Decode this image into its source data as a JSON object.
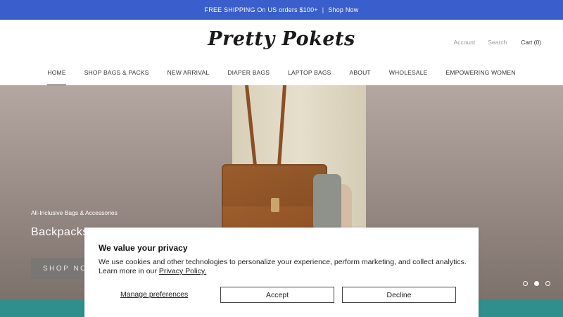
{
  "announcement": {
    "text": "FREE SHIPPING On US orders $100+",
    "separator": "|",
    "link": "Shop Now"
  },
  "header": {
    "logo": "Pretty Pokets",
    "account": "Account",
    "search": "Search",
    "cart": "Cart (0)"
  },
  "nav": {
    "items": [
      {
        "label": "HOME"
      },
      {
        "label": "SHOP BAGS & PACKS"
      },
      {
        "label": "NEW ARRIVAL"
      },
      {
        "label": "DIAPER BAGS"
      },
      {
        "label": "LAPTOP BAGS"
      },
      {
        "label": "ABOUT"
      },
      {
        "label": "WHOLESALE"
      },
      {
        "label": "EMPOWERING WOMEN"
      }
    ],
    "active": "HOME"
  },
  "hero": {
    "kicker": "All-Inclusive Bags & Accessories",
    "title": "Backpacks,",
    "button": "SHOP NOW",
    "slides": {
      "count": 3,
      "active": 2
    }
  },
  "cookie": {
    "title": "We value your privacy",
    "text": "We use cookies and other technologies to personalize your experience, perform marketing, and collect analytics. Learn more in our",
    "policy_link": "Privacy Policy.",
    "manage": "Manage preferences",
    "accept": "Accept",
    "decline": "Decline"
  },
  "colors": {
    "announcement_bg": "#3a5ecb",
    "band_bg": "#2e8f8c"
  }
}
